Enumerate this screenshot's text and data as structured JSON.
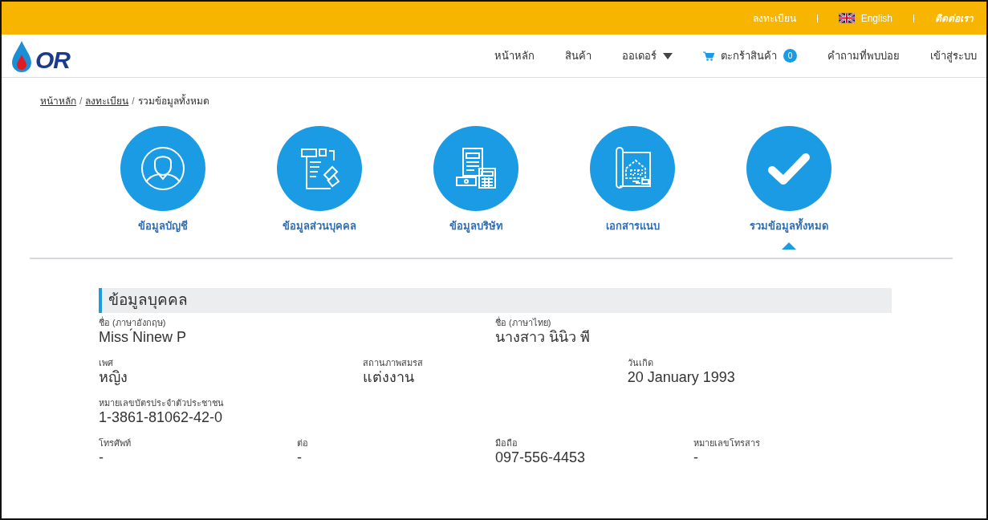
{
  "top_bar": {
    "links": [
      {
        "label": "ลงทะเบียน",
        "kind": "plain"
      },
      {
        "label": "English",
        "kind": "language"
      },
      {
        "label": "ติดต่อเรา",
        "kind": "emphasis"
      }
    ]
  },
  "navbar": {
    "logo": "OR",
    "items": [
      {
        "label": "หน้าหลัก",
        "kind": "plain"
      },
      {
        "label": "สินค้า",
        "kind": "plain"
      },
      {
        "label": "ออเดอร์",
        "kind": "dropdown"
      },
      {
        "label": "ตะกร้าสินค้า",
        "kind": "cart",
        "badge": "0"
      },
      {
        "label": "คำถามที่พบบ่อย",
        "kind": "plain"
      },
      {
        "label": "เข้าสู่ระบบ",
        "kind": "plain"
      }
    ]
  },
  "breadcrumb": [
    {
      "label": "หน้าหลัก",
      "link": true,
      "separator": "/"
    },
    {
      "label": "ลงทะเบียน",
      "link": true,
      "separator": "/"
    },
    {
      "label": "รวมข้อมูลทั้งหมด",
      "link": false
    }
  ],
  "steps": [
    {
      "label": "ข้อมูลบัญชี",
      "kind": "person",
      "selected": false
    },
    {
      "label": "ข้อมูลส่วนบุคคล",
      "kind": "form",
      "selected": false
    },
    {
      "label": "ข้อมูลบริษัท",
      "kind": "calculator",
      "selected": false
    },
    {
      "label": "เอกสารแนบ",
      "kind": "blueprint",
      "selected": false
    },
    {
      "label": "รวมข้อมูลทั้งหมด",
      "kind": "check",
      "selected": true
    }
  ],
  "section": {
    "title": "ข้อมูลบุคคล",
    "groups": [
      {
        "fields": [
          {
            "label": "ชื่อ (ภาษาอังกฤษ)",
            "value": "Miss ́Ninew P"
          },
          {
            "label": "ชื่อ (ภาษาไทย)",
            "value": "นางสาว นินิว พี"
          }
        ]
      },
      {
        "fields": [
          {
            "label": "เพศ",
            "value": "หญิง"
          },
          {
            "label": "สถานภาพสมรส",
            "value": "แต่งงาน"
          },
          {
            "label": "วันเกิด",
            "value": "20 January 1993"
          }
        ]
      },
      {
        "fields": [
          {
            "label": "หมายเลขบัตรประจำตัวประชาชน",
            "value": "1-3861-81062-42-0"
          }
        ]
      },
      {
        "fields": [
          {
            "label": "โทรศัพท์",
            "value": "-"
          },
          {
            "label": "ต่อ",
            "value": "-"
          },
          {
            "label": "มือถือ",
            "value": "097-556-4453"
          },
          {
            "label": "หมายเลขโทรสาร",
            "value": "-"
          }
        ]
      }
    ]
  }
}
